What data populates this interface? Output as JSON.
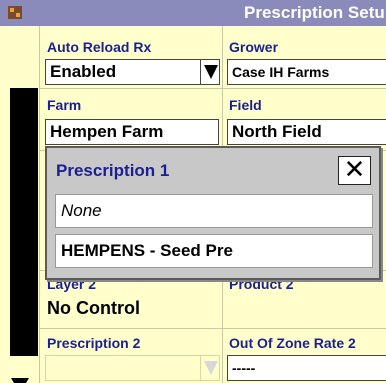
{
  "window": {
    "title": "Prescription Setu"
  },
  "auto_reload": {
    "label": "Auto Reload Rx",
    "value": "Enabled"
  },
  "grower": {
    "label": "Grower",
    "value": "Case IH Farms"
  },
  "farm": {
    "label": "Farm",
    "value": "Hempen Farm"
  },
  "field": {
    "label": "Field",
    "value": "North Field"
  },
  "layer2": {
    "label": "Layer 2",
    "value": "No Control"
  },
  "product2": {
    "label": "Product 2"
  },
  "prescription2": {
    "label": "Prescription 2",
    "value": ""
  },
  "out_of_zone": {
    "label": "Out Of Zone Rate 2",
    "value": "-----"
  },
  "dialog": {
    "title": "Prescription 1",
    "close_glyph": "✕",
    "options": [
      "None",
      "HEMPENS - Seed Pre"
    ]
  },
  "icons": {
    "app": "monitor-grid-icon",
    "dropdown": "triangle-down-icon",
    "scroll": "scroll-down-icon"
  },
  "colors": {
    "title_bar": "#8a8abb",
    "label": "#1a1f96",
    "panel": "#ffffcc",
    "dialog": "#c8c8c8"
  }
}
